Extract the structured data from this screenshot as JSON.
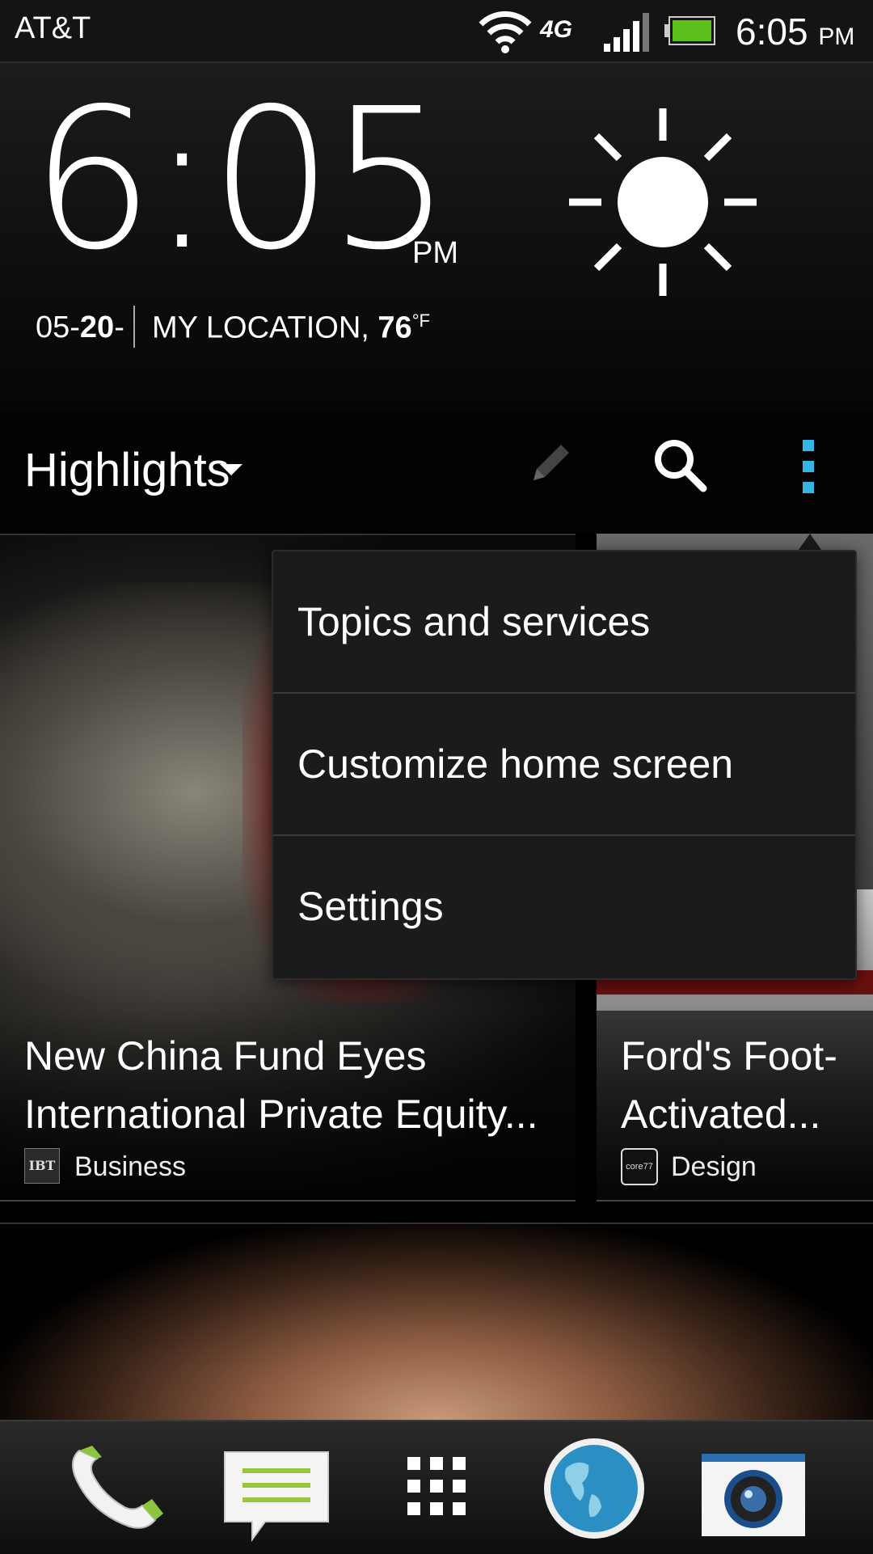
{
  "status_bar": {
    "carrier": "AT&T",
    "network": "4G",
    "time": "6:05",
    "time_suffix": "PM",
    "icons": [
      "wifi-icon",
      "signal-icon",
      "battery-icon"
    ]
  },
  "clock_widget": {
    "time": "6:05",
    "ampm": "PM",
    "date_prefix": "05-",
    "date_day": "20",
    "date_suffix": "-",
    "location": "MY LOCATION,",
    "temperature": "76",
    "temp_unit": "°F",
    "weather_icon": "sun-icon"
  },
  "feed_header": {
    "title": "Highlights",
    "icons": [
      "pencil-icon",
      "search-icon",
      "overflow-menu-icon"
    ],
    "accent_color": "#33b5e5"
  },
  "tiles": [
    {
      "title": "New China Fund Eyes International Private Equity...",
      "source_icon_text": "IBT",
      "source": "Business"
    },
    {
      "title": "Ford's Foot-Activated...",
      "source_icon_text": "core77",
      "source": "Design"
    }
  ],
  "menu": {
    "items": [
      "Topics and services",
      "Customize home screen",
      "Settings"
    ]
  },
  "dock": {
    "items": [
      "phone-icon",
      "messages-icon",
      "app-drawer-icon",
      "browser-icon",
      "camera-icon"
    ]
  }
}
